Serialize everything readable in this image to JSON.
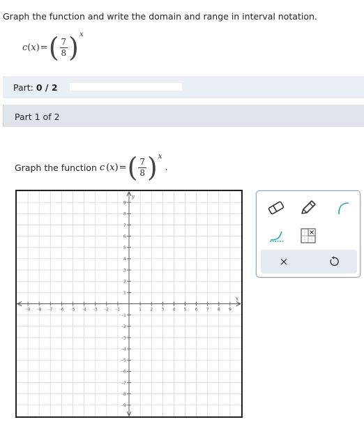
{
  "prompt": "Graph the function and write the domain and range in interval notation.",
  "function": {
    "name": "c",
    "variable": "x",
    "equals": "=",
    "open_paren": "(",
    "close_paren": ")",
    "numerator": "7",
    "denominator": "8",
    "exponent": "x"
  },
  "part_status": {
    "label": "Part:",
    "value": "0 / 2",
    "progress_fraction": 0.0,
    "accent_color": "#3a87c8"
  },
  "part_header": "Part 1 of 2",
  "graph_instruction": {
    "text": "Graph the function",
    "period": "."
  },
  "axes": {
    "x_label": "x",
    "y_label": "y",
    "x_ticks": [
      "-9",
      "-8",
      "-7",
      "-6",
      "-5",
      "-4",
      "-3",
      "-2",
      "-1",
      "1",
      "2",
      "3",
      "4",
      "5",
      "6",
      "7",
      "8",
      "9"
    ],
    "y_ticks": [
      "9",
      "8",
      "7",
      "6",
      "5",
      "4",
      "3",
      "2",
      "1",
      "-1",
      "-2",
      "-3",
      "-4",
      "-5",
      "-6",
      "-7",
      "-8",
      "-9"
    ],
    "range": [
      -10,
      10
    ]
  },
  "tools": {
    "eraser": "eraser-icon",
    "pencil": "pencil-icon",
    "curve": "curve-icon",
    "exponential": "exponential-curve-icon",
    "interval": "interval-grid-icon",
    "clear": "×",
    "undo": "undo-icon",
    "accent_color": "#2aa6b3"
  }
}
